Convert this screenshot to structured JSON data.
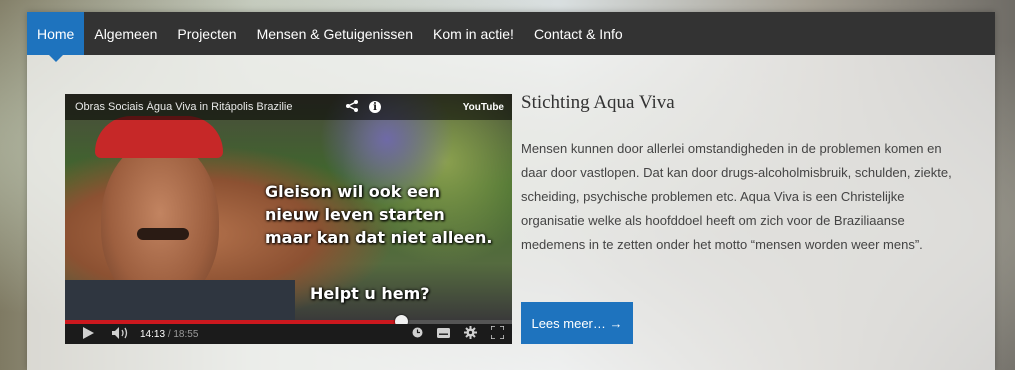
{
  "nav": {
    "items": [
      {
        "label": "Home",
        "active": true
      },
      {
        "label": "Algemeen",
        "active": false
      },
      {
        "label": "Projecten",
        "active": false
      },
      {
        "label": "Mensen & Getuigenissen",
        "active": false
      },
      {
        "label": "Kom in actie!",
        "active": false
      },
      {
        "label": "Contact & Info",
        "active": false
      }
    ]
  },
  "video": {
    "title": "Obras Sociais Água Viva in  Ritápolis Brazilie",
    "share_icon": "share-icon",
    "info_icon": "info-icon",
    "info_glyph": "i",
    "logo": "YouTube",
    "overlay_lines": [
      "Gleison wil ook een",
      "nieuw leven starten",
      "maar kan dat niet alleen."
    ],
    "overlay_question": "Helpt u hem?",
    "current_time": "14:13",
    "duration": "/ 18:55",
    "progress": 0.751,
    "controls": {
      "play_icon": "play-icon",
      "volume_icon": "volume-icon",
      "watch_later_icon": "clock-icon",
      "captions_icon": "captions-icon",
      "settings_icon": "gear-icon",
      "fullscreen_icon": "fullscreen-icon"
    }
  },
  "content": {
    "heading": "Stichting Aqua Viva",
    "paragraph": "Mensen kunnen door allerlei omstandigheden in de problemen komen en daar door vastlopen. Dat kan door drugs-alcoholmisbruik, schulden, ziekte, scheiding, psychische problemen etc. Aqua Viva is een Christelijke organisatie welke als hoofddoel heeft om zich voor de Braziliaanse medemens  in te zetten onder het motto “mensen worden weer mens”.",
    "button_label": "Lees meer… →"
  },
  "colors": {
    "accent": "#1e73be",
    "navbar": "#333333",
    "progress_red": "#cc181e"
  }
}
